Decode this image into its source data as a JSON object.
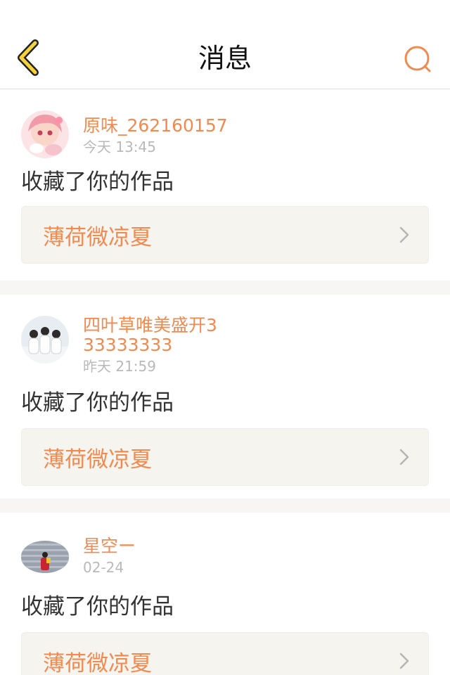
{
  "nav": {
    "title": "消息"
  },
  "messages": [
    {
      "username": "原味_262160157",
      "time": "今天 13:45",
      "action": "收藏了你的作品",
      "work_title": "薄荷微凉夏"
    },
    {
      "username": "四叶草唯美盛开333333333",
      "time": "昨天 21:59",
      "action": "收藏了你的作品",
      "work_title": "薄荷微凉夏"
    },
    {
      "username": "星空ー",
      "time": "02-24",
      "action": "收藏了你的作品",
      "work_title": "薄荷微凉夏"
    }
  ],
  "colors": {
    "accent": "#f28a4f",
    "back_arrow_fill": "#f7d23c",
    "background": "#f7f6f4",
    "work_box": "#f5f4ef"
  },
  "icons": {
    "back": "chevron-left-icon",
    "search": "search-icon",
    "row_arrow": "chevron-right-icon"
  }
}
